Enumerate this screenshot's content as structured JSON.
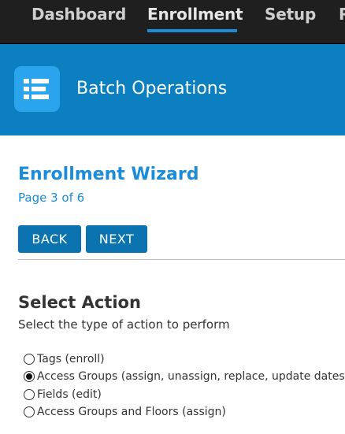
{
  "nav": {
    "items": [
      {
        "label": "Dashboard",
        "active": false
      },
      {
        "label": "Enrollment",
        "active": true
      },
      {
        "label": "Setup",
        "active": false
      },
      {
        "label": "R",
        "active": false
      }
    ]
  },
  "banner": {
    "icon": "list-app-icon",
    "title": "Batch Operations"
  },
  "wizard": {
    "title": "Enrollment Wizard",
    "page": "Page 3 of 6",
    "back_label": "BACK",
    "next_label": "NEXT"
  },
  "action": {
    "title": "Select Action",
    "description": "Select the type of action to perform",
    "options": [
      {
        "label": "Tags (enroll)",
        "checked": false
      },
      {
        "label": "Access Groups (assign, unassign, replace, update dates)",
        "checked": true
      },
      {
        "label": "Fields (edit)",
        "checked": false
      },
      {
        "label": "Access Groups and Floors (assign)",
        "checked": false
      }
    ]
  },
  "colors": {
    "accent": "#1a8cd8",
    "banner": "#0b7fc0",
    "button": "#0b74b0",
    "topbar": "#1f1f1f"
  }
}
